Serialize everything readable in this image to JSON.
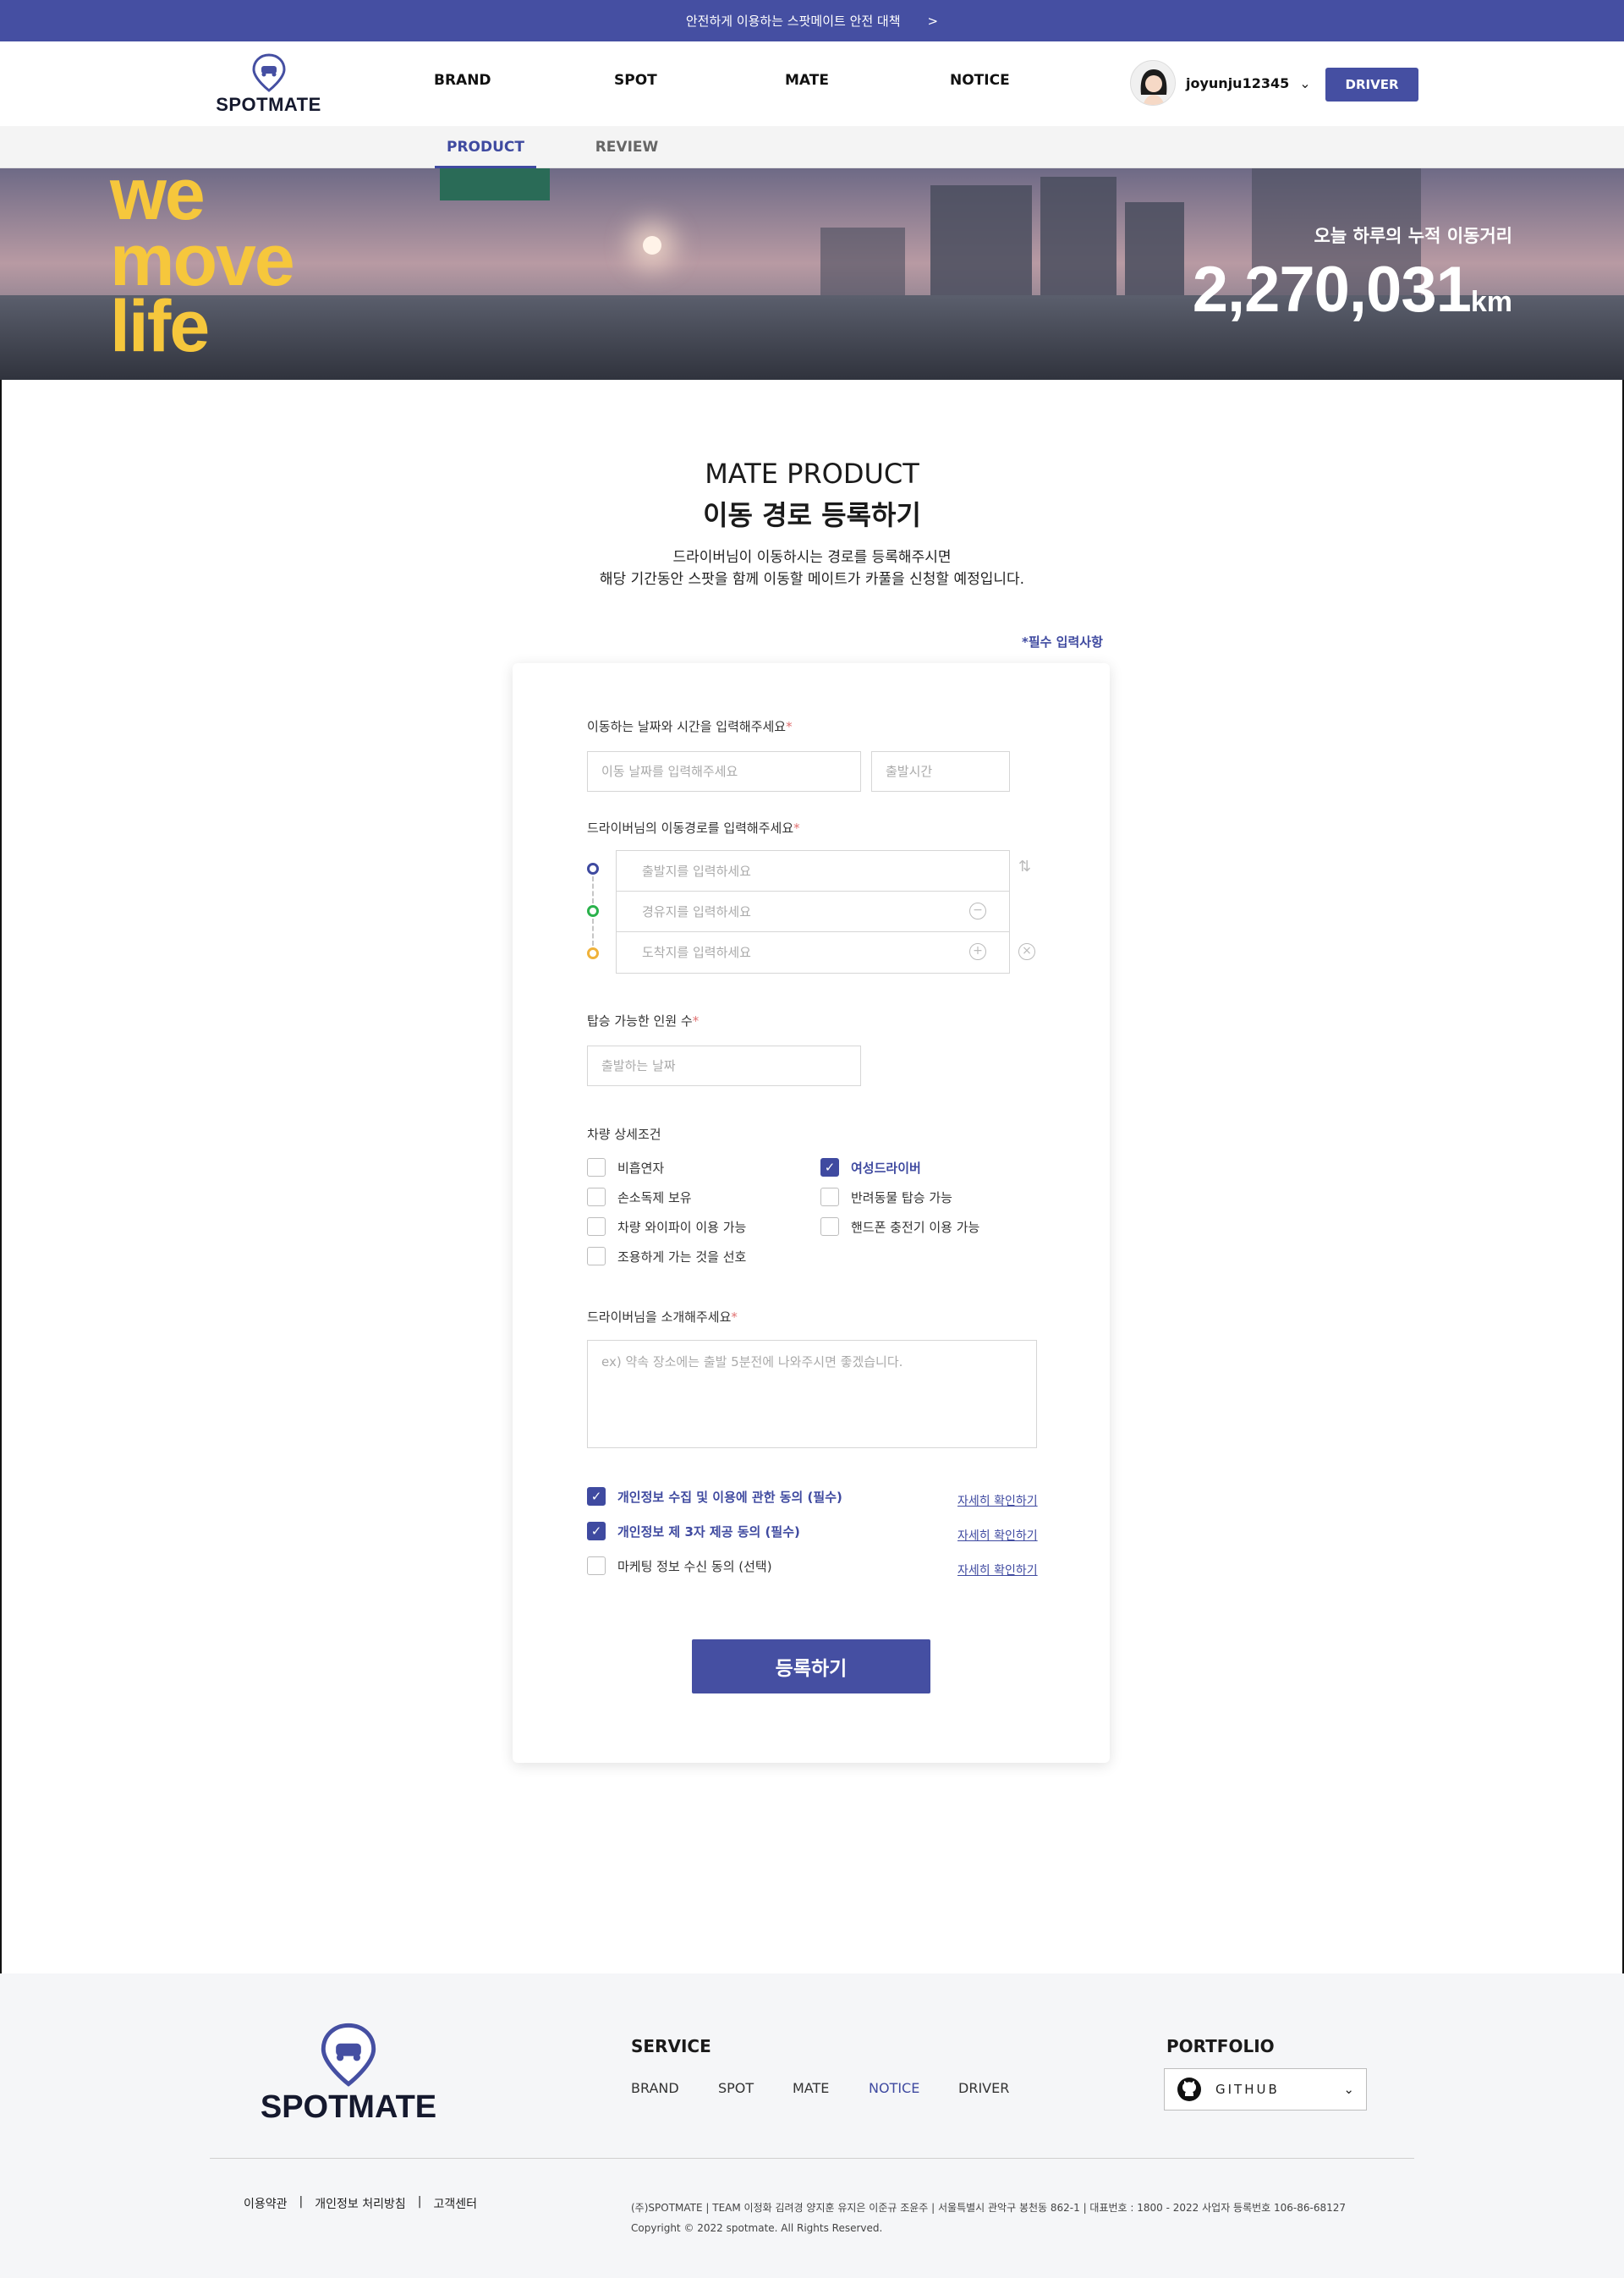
{
  "topbar": {
    "text": "안전하게 이용하는 스팟메이트 안전 대책",
    "arrow": ">"
  },
  "brand": {
    "name": "SPOTMATE",
    "accent": "#454fa2",
    "slogan_color": "#f6c73c"
  },
  "nav": {
    "items": [
      "BRAND",
      "SPOT",
      "MATE",
      "NOTICE"
    ]
  },
  "user": {
    "name": "joyunju12345",
    "driver_label": "DRIVER"
  },
  "subnav": {
    "tabs": [
      "PRODUCT",
      "REVIEW"
    ],
    "active": "PRODUCT"
  },
  "hero": {
    "slogan": [
      "we",
      "move",
      "life"
    ],
    "distance_label": "오늘 하루의 누적 이동거리",
    "distance_value": "2,270,031",
    "distance_unit": "km"
  },
  "page": {
    "title_en": "MATE PRODUCT",
    "title_ko": "이동 경로 등록하기",
    "desc_line1": "드라이버님이 이동하시는 경로를 등록해주시면",
    "desc_line2": "해당 기간동안 스팟을 함께 이동할 메이트가 카풀을 신청할 예정입니다.",
    "required_note": "*필수 입력사항"
  },
  "form": {
    "datetime_label": "이동하는 날짜와 시간을 입력해주세요",
    "date_placeholder": "이동 날짜를 입력해주세요",
    "time_placeholder": "출발시간",
    "route_label": "드라이버님의 이동경로를 입력해주세요",
    "route_start": "출발지를 입력하세요",
    "route_via": "경유지를 입력하세요",
    "route_end": "도착지를 입력하세요",
    "seats_label": "탑승 가능한 인원 수",
    "seats_placeholder": "출발하는 날짜",
    "options_label": "차량 상세조건",
    "options": [
      {
        "label": "비흡연자",
        "checked": false
      },
      {
        "label": "여성드라이버",
        "checked": true
      },
      {
        "label": "손소독제 보유",
        "checked": false
      },
      {
        "label": "반려동물 탑승 가능",
        "checked": false
      },
      {
        "label": "차량 와이파이 이용 가능",
        "checked": false
      },
      {
        "label": "핸드폰 충전기 이용 가능",
        "checked": false
      },
      {
        "label": "조용하게 가는 것을 선호",
        "checked": false
      }
    ],
    "intro_label": "드라이버님을 소개해주세요",
    "intro_placeholder": "ex) 약속 장소에는 출발 5분전에 나와주시면 좋겠습니다.",
    "agreements": [
      {
        "label": "개인정보 수집 및 이용에 관한 동의 (필수)",
        "checked": true,
        "link": "자세히 확인하기"
      },
      {
        "label": "개인정보 제 3자 제공 동의 (필수)",
        "checked": true,
        "link": "자세히 확인하기"
      },
      {
        "label": "마케팅 정보 수신 동의 (선택)",
        "checked": false,
        "link": "자세히 확인하기"
      }
    ],
    "submit_label": "등록하기",
    "required_mark": "*"
  },
  "footer": {
    "service_heading": "SERVICE",
    "service_links": [
      "BRAND",
      "SPOT",
      "MATE",
      "NOTICE",
      "DRIVER"
    ],
    "portfolio_heading": "PORTFOLIO",
    "github_label": "GITHUB",
    "policy_links": [
      "이용약관",
      "|",
      "개인정보 처리방침",
      "|",
      "고객센터"
    ],
    "info_line": "(주)SPOTMATE | TEAM 이정화 김려경 양지훈 유지은 이준규 조윤주 | 서울특별시 관악구 봉천동 862-1 | 대표번호 : 1800 - 2022 사업자 등록번호 106-86-68127",
    "copyright": "Copyright © 2022 spotmate. All Rights Reserved."
  }
}
